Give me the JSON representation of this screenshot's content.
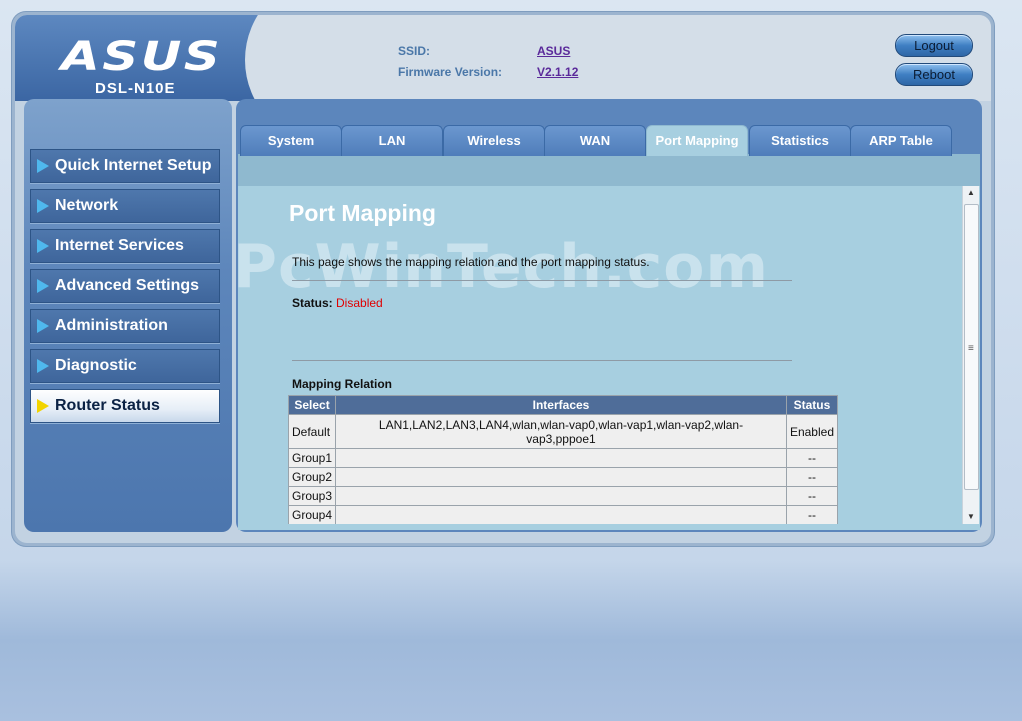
{
  "header": {
    "logo": "ASUS",
    "model": "DSL-N10E",
    "ssid_label": "SSID:",
    "ssid_value": "ASUS",
    "firmware_label": "Firmware Version:",
    "firmware_value": "V2.1.12",
    "logout_label": "Logout",
    "reboot_label": "Reboot"
  },
  "sidebar": {
    "items": [
      {
        "label": "Quick Internet Setup"
      },
      {
        "label": "Network"
      },
      {
        "label": "Internet Services"
      },
      {
        "label": "Advanced Settings"
      },
      {
        "label": "Administration"
      },
      {
        "label": "Diagnostic"
      },
      {
        "label": "Router Status",
        "active": true
      }
    ]
  },
  "tabs": [
    {
      "label": "System"
    },
    {
      "label": "LAN"
    },
    {
      "label": "Wireless"
    },
    {
      "label": "WAN"
    },
    {
      "label": "Port Mapping",
      "active": true
    },
    {
      "label": "Statistics"
    },
    {
      "label": "ARP Table"
    }
  ],
  "main": {
    "title": "Port Mapping",
    "description": "This page shows the mapping relation and the port mapping status.",
    "status_label": "Status:",
    "status_value": "Disabled",
    "watermark": "PcWinTech.com",
    "mapping_title": "Mapping Relation",
    "table": {
      "headers": [
        "Select",
        "Interfaces",
        "Status"
      ],
      "rows": [
        [
          "Default",
          "LAN1,LAN2,LAN3,LAN4,wlan,wlan-vap0,wlan-vap1,wlan-vap2,wlan-vap3,pppoe1",
          "Enabled"
        ],
        [
          "Group1",
          "",
          "--"
        ],
        [
          "Group2",
          "",
          "--"
        ],
        [
          "Group3",
          "",
          "--"
        ],
        [
          "Group4",
          "",
          "--"
        ]
      ]
    }
  },
  "colors": {
    "status_disabled": "#e00000",
    "table_header": "#4f6d99",
    "active_arrow": "#f2d400",
    "menu_arrow": "#4fb8ee"
  }
}
